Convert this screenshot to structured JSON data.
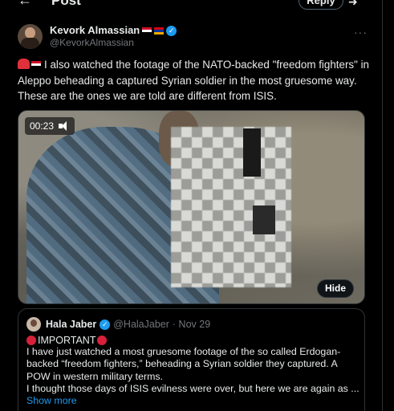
{
  "header": {
    "back_icon": "arrow-left-icon",
    "title": "Post",
    "reply_label": "Reply",
    "extra_icon": "composer-icon"
  },
  "author": {
    "name": "Kevork Almassian",
    "flags": [
      "syria-flag",
      "armenia-flag"
    ],
    "handle": "@KevorkAlmassian",
    "verified": true,
    "more_label": "···"
  },
  "tweet": {
    "text": "I also watched the footage of the NATO-backed \"freedom fighters\" in Aleppo beheading a captured Syrian soldier in the most gruesome way. These are the ones we are told are different from ISIS.",
    "leading_emojis": [
      "siren-icon",
      "syria-flag"
    ]
  },
  "video": {
    "time": "00:23",
    "mute_icon": "speaker-muted-icon",
    "hide_label": "Hide"
  },
  "quote": {
    "name": "Hala Jaber",
    "handle": "@HalaJaber",
    "date": "· Nov 29",
    "important_label": "IMPORTANT",
    "body": "I have just watched a most gruesome footage of the so called Erdogan-backed “freedom fighters,” beheading a Syrian soldier they captured. A POW in western military terms.\nI thought those days of ISIS evilness were over, but here we are again as ...",
    "show_more": "Show more"
  },
  "colors": {
    "background": "#000000",
    "text": "#e7e9ea",
    "muted": "#71767b",
    "accent": "#1d9bf0",
    "border": "#2f3336"
  }
}
